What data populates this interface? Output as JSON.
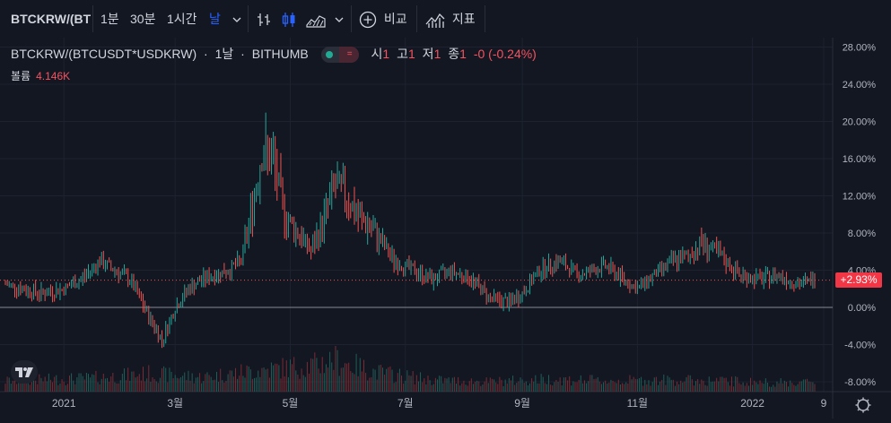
{
  "toolbar": {
    "symbol": "BTCKRW/(BT",
    "intervals": [
      "1분",
      "30분",
      "1시간",
      "날"
    ],
    "compare_label": "비교",
    "indicators_label": "지표"
  },
  "legend": {
    "title": "BTCKRW/(BTCUSDT*USDKRW)",
    "sep1": "·",
    "interval": "1날",
    "sep2": "·",
    "exchange": "BITHUMB",
    "o_label": "시",
    "o_val": "1",
    "h_label": "고",
    "h_val": "1",
    "l_label": "저",
    "l_val": "1",
    "c_label": "종",
    "c_val": "1",
    "change": "-0 (-0.24%)",
    "volume_label": "볼륨",
    "volume_value": "4.146K"
  },
  "colors": {
    "up": "#26a69a",
    "down": "#ef5350",
    "background": "#131722",
    "accent": "#2962ff"
  },
  "icons": [
    "chevron-down-icon",
    "bar-style-icon",
    "candle-style-icon",
    "area-style-icon",
    "plus-circle-icon",
    "indicators-icon",
    "tradingview-logo-icon",
    "settings-icon"
  ],
  "chart_data": {
    "type": "candlestick",
    "y_axis_unit": "%",
    "ylim": [
      -9,
      29
    ],
    "y_ticks": [
      "28.00%",
      "24.00%",
      "20.00%",
      "16.00%",
      "12.00%",
      "8.00%",
      "4.00%",
      "0.00%",
      "-4.00%",
      "-8.00%"
    ],
    "x_ticks": [
      "2021",
      "3월",
      "5월",
      "7월",
      "9월",
      "11월",
      "2022",
      "9"
    ],
    "x_range": [
      "2020-12-01",
      "2022-02-03"
    ],
    "last_value_label": "+2.93%",
    "last_value": 2.93,
    "series": [
      {
        "name": "BTCKRW/(BTCUSDT*USDKRW)",
        "kind": "candles",
        "points": [
          [
            "2020-12-01",
            2.5
          ],
          [
            "2020-12-20",
            1.5
          ],
          [
            "2021-01-01",
            2.0
          ],
          [
            "2021-01-10",
            3.0
          ],
          [
            "2021-01-20",
            5.0
          ],
          [
            "2021-01-28",
            4.0
          ],
          [
            "2021-02-05",
            3.0
          ],
          [
            "2021-02-15",
            -1.0
          ],
          [
            "2021-02-22",
            -3.5
          ],
          [
            "2021-03-01",
            0.0
          ],
          [
            "2021-03-08",
            2.0
          ],
          [
            "2021-03-15",
            3.0
          ],
          [
            "2021-03-22",
            3.5
          ],
          [
            "2021-03-29",
            4.0
          ],
          [
            "2021-04-05",
            5.0
          ],
          [
            "2021-04-12",
            12.0
          ],
          [
            "2021-04-16",
            17.0
          ],
          [
            "2021-04-22",
            15.5
          ],
          [
            "2021-04-28",
            10.0
          ],
          [
            "2021-05-05",
            8.0
          ],
          [
            "2021-05-12",
            6.0
          ],
          [
            "2021-05-18",
            9.0
          ],
          [
            "2021-05-24",
            13.0
          ],
          [
            "2021-05-31",
            12.0
          ],
          [
            "2021-06-05",
            10.0
          ],
          [
            "2021-06-15",
            8.0
          ],
          [
            "2021-06-25",
            5.0
          ],
          [
            "2021-07-05",
            4.0
          ],
          [
            "2021-07-15",
            3.0
          ],
          [
            "2021-07-25",
            4.0
          ],
          [
            "2021-08-05",
            3.0
          ],
          [
            "2021-08-15",
            1.0
          ],
          [
            "2021-08-25",
            0.5
          ],
          [
            "2021-09-01",
            1.5
          ],
          [
            "2021-09-10",
            4.0
          ],
          [
            "2021-09-20",
            5.0
          ],
          [
            "2021-10-01",
            3.5
          ],
          [
            "2021-10-15",
            4.5
          ],
          [
            "2021-10-25",
            3.0
          ],
          [
            "2021-11-01",
            2.0
          ],
          [
            "2021-11-10",
            3.5
          ],
          [
            "2021-11-20",
            5.0
          ],
          [
            "2021-11-28",
            5.5
          ],
          [
            "2021-12-05",
            7.0
          ],
          [
            "2021-12-15",
            5.5
          ],
          [
            "2021-12-25",
            3.5
          ],
          [
            "2022-01-05",
            3.0
          ],
          [
            "2022-01-15",
            3.5
          ],
          [
            "2022-01-25",
            2.5
          ],
          [
            "2022-02-03",
            2.93
          ]
        ]
      },
      {
        "name": "볼륨",
        "kind": "volume",
        "points": [
          [
            "2020-12-01",
            1.2
          ],
          [
            "2021-01-15",
            1.5
          ],
          [
            "2021-02-15",
            2.0
          ],
          [
            "2021-03-15",
            1.6
          ],
          [
            "2021-04-15",
            2.4
          ],
          [
            "2021-05-15",
            3.0
          ],
          [
            "2021-05-24",
            3.6
          ],
          [
            "2021-06-15",
            2.2
          ],
          [
            "2021-07-15",
            1.3
          ],
          [
            "2021-08-15",
            1.1
          ],
          [
            "2021-09-15",
            1.4
          ],
          [
            "2021-10-15",
            1.2
          ],
          [
            "2021-11-15",
            1.3
          ],
          [
            "2021-12-15",
            1.2
          ],
          [
            "2022-01-15",
            1.0
          ],
          [
            "2022-02-03",
            1.1
          ]
        ]
      }
    ]
  }
}
